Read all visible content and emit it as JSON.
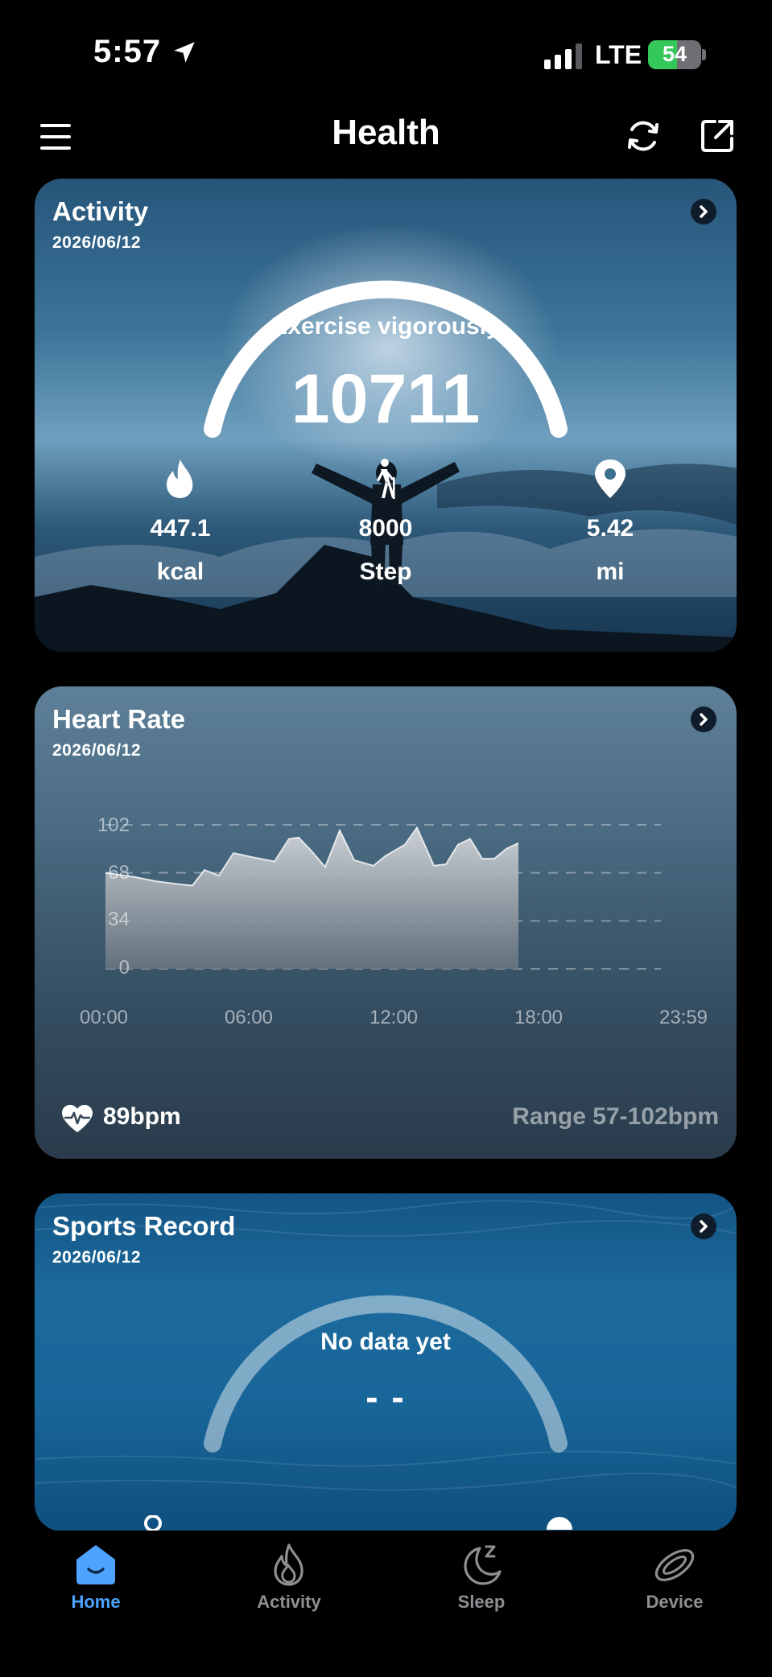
{
  "status_bar": {
    "time": "5:57",
    "network": "LTE",
    "battery": "54",
    "battery_level": 0.54
  },
  "header": {
    "title": "Health"
  },
  "activity": {
    "title": "Activity",
    "date": "2026/06/12",
    "status": "Exercise vigorously",
    "total": "10711",
    "metrics": [
      {
        "icon": "flame-icon",
        "value": "447.1",
        "unit": "kcal"
      },
      {
        "icon": "hiker-icon",
        "value": "8000",
        "unit": "Step"
      },
      {
        "icon": "location-pin-icon",
        "value": "5.42",
        "unit": "mi"
      }
    ]
  },
  "heart_rate": {
    "title": "Heart Rate",
    "date": "2026/06/12",
    "current": "89bpm",
    "range": "Range 57-102bpm",
    "chart_data": {
      "type": "area",
      "y_ticks": [
        "102",
        "68",
        "34",
        "0"
      ],
      "ylim": [
        0,
        102
      ],
      "x_ticks": [
        "00:00",
        "06:00",
        "12:00",
        "18:00",
        "23:59"
      ],
      "x_hours": [
        0,
        1.2,
        2.1,
        3.0,
        3.6,
        4.1,
        4.7,
        5.3,
        6.1,
        7.0,
        7.6,
        8.0,
        8.5,
        9.1,
        9.7,
        10.3,
        11.1,
        11.6,
        12.4,
        12.9,
        13.6,
        14.1,
        14.6,
        15.1,
        15.6,
        16.1,
        16.6,
        17.1
      ],
      "values": [
        68,
        65,
        62,
        60,
        59,
        70,
        66,
        82,
        79,
        76,
        92,
        93,
        84,
        72,
        98,
        77,
        73,
        80,
        88,
        100,
        73,
        74,
        88,
        92,
        78,
        78,
        85,
        89
      ],
      "grid": true,
      "color": "#c9ced3"
    }
  },
  "sports": {
    "title": "Sports Record",
    "date": "2026/06/12",
    "status": "No data yet",
    "placeholder": "- -"
  },
  "tabs": [
    {
      "label": "Home",
      "icon": "home-icon",
      "active": true
    },
    {
      "label": "Activity",
      "icon": "flame-icon",
      "active": false
    },
    {
      "label": "Sleep",
      "icon": "moon-icon",
      "active": false
    },
    {
      "label": "Device",
      "icon": "band-icon",
      "active": false
    }
  ],
  "colors": {
    "accent": "#4da3ff",
    "inactive": "#8e8e93",
    "battery": "#34c759"
  }
}
